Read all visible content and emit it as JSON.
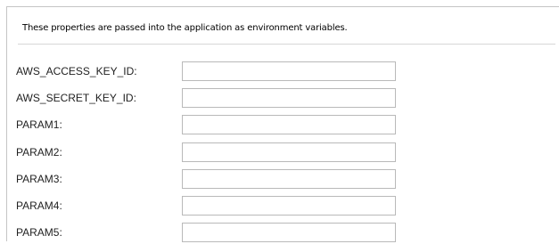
{
  "form": {
    "description": "These properties are passed into the application as environment variables.",
    "fields": [
      {
        "label": "AWS_ACCESS_KEY_ID:",
        "value": ""
      },
      {
        "label": "AWS_SECRET_KEY_ID:",
        "value": ""
      },
      {
        "label": "PARAM1:",
        "value": ""
      },
      {
        "label": "PARAM2:",
        "value": ""
      },
      {
        "label": "PARAM3:",
        "value": ""
      },
      {
        "label": "PARAM4:",
        "value": ""
      },
      {
        "label": "PARAM5:",
        "value": ""
      }
    ]
  }
}
